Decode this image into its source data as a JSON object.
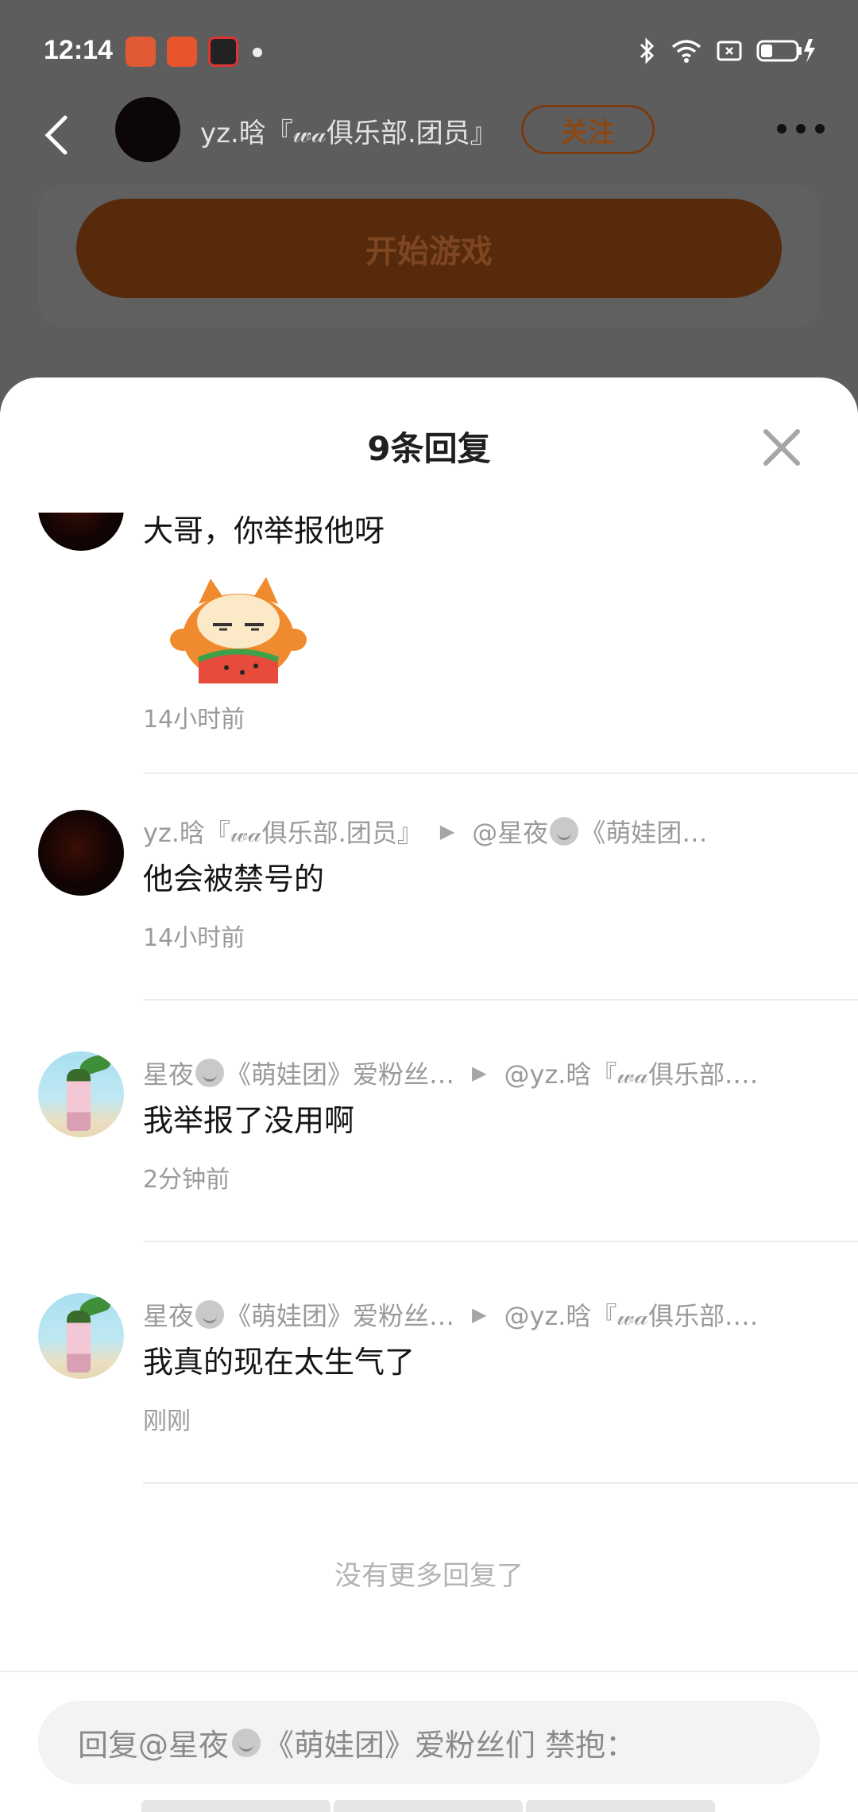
{
  "status_bar": {
    "time": "12:14"
  },
  "header": {
    "username": "yz.晗『𝓌𝒶俱乐部.团员』",
    "follow_label": "关注",
    "start_game_label": "开始游戏"
  },
  "sheet": {
    "title": "9条回复",
    "comments": [
      {
        "text": "大哥，你举报他呀",
        "time": "14小时前",
        "has_sticker": true
      },
      {
        "author": "yz.晗『𝓌𝒶俱乐部.团员』",
        "reply_to_prefix": "@星夜",
        "reply_to_suffix": "《萌娃团…",
        "text": "他会被禁号的",
        "time": "14小时前"
      },
      {
        "author_prefix": "星夜",
        "author_suffix": "《萌娃团》爱粉丝…",
        "reply_to": "@yz.晗『𝓌𝒶俱乐部.…",
        "text": "我举报了没用啊",
        "time": "2分钟前"
      },
      {
        "author_prefix": "星夜",
        "author_suffix": "《萌娃团》爱粉丝…",
        "reply_to": "@yz.晗『𝓌𝒶俱乐部.…",
        "text": "我真的现在太生气了",
        "time": "刚刚"
      }
    ],
    "no_more_text": "没有更多回复了",
    "reply_placeholder_prefix": "回复@星夜",
    "reply_placeholder_suffix": "《萌娃团》爱粉丝们 禁抱："
  },
  "icons": {
    "back": "chevron-left-icon",
    "more": "more-horizontal-icon",
    "close": "close-icon",
    "bluetooth": "bluetooth-icon",
    "wifi": "wifi-icon",
    "battery": "battery-charging-icon"
  }
}
